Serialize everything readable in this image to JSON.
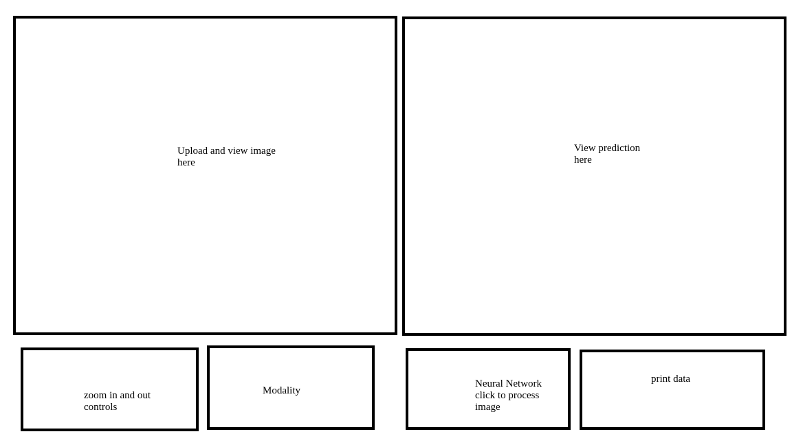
{
  "panels": {
    "upload": {
      "text": "Upload and view image\nhere"
    },
    "prediction": {
      "text": "View prediction\nhere"
    },
    "zoom": {
      "text": "zoom in and out\ncontrols"
    },
    "modality": {
      "text": "Modality"
    },
    "neural_network": {
      "text": "Neural Network\nclick to process\nimage"
    },
    "print": {
      "text": "print data"
    }
  }
}
